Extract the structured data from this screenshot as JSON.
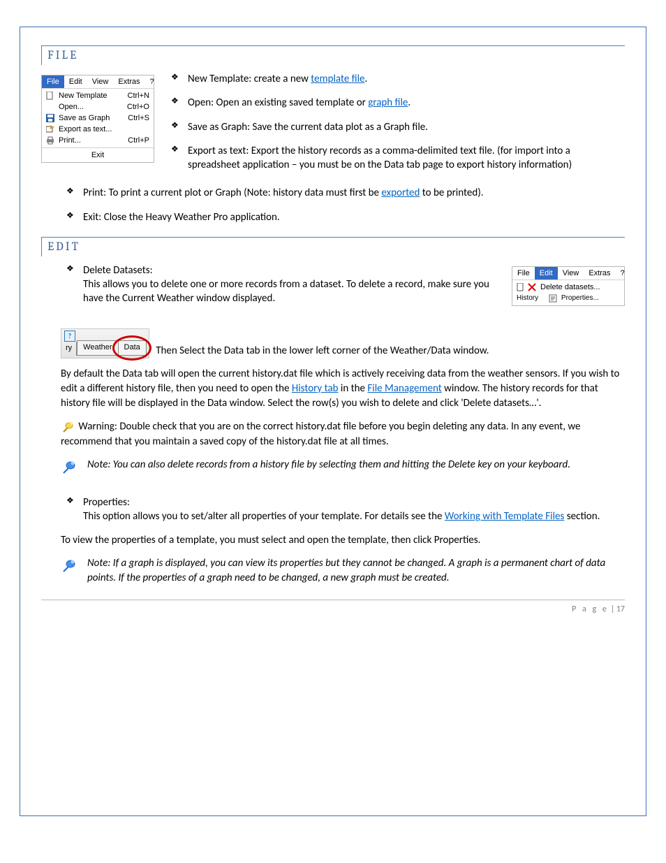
{
  "sections": {
    "file": {
      "heading": "FILE"
    },
    "edit": {
      "heading": "EDIT"
    }
  },
  "file_menu": {
    "bar": {
      "file": "File",
      "edit": "Edit",
      "view": "View",
      "extras": "Extras",
      "help": "?"
    },
    "items": {
      "new_template": {
        "label": "New Template",
        "shortcut": "Ctrl+N"
      },
      "open": {
        "label": "Open...",
        "shortcut": "Ctrl+O"
      },
      "save_as_graph": {
        "label": "Save as Graph",
        "shortcut": "Ctrl+S"
      },
      "export_as_text": {
        "label": "Export as text..."
      },
      "print": {
        "label": "Print...",
        "shortcut": "Ctrl+P"
      },
      "exit": {
        "label": "Exit"
      }
    }
  },
  "file_bullets": {
    "new_template": {
      "pre": "New Template: create a new ",
      "link": "template file",
      "post": "."
    },
    "open": {
      "pre": "Open: Open an existing saved template or ",
      "link": "graph file",
      "post": "."
    },
    "save_as_graph": "Save as Graph: Save the current data plot as a Graph file.",
    "export_as_text": "Export as text: Export the history records as a comma-delimited text file. (for import into a spreadsheet application – you must be on the Data tab page to export history information)",
    "print": {
      "pre": "Print: To print a current plot or Graph (Note: history data must first be ",
      "link": "exported",
      "post": " to be printed)."
    },
    "exit": "Exit: Close the Heavy Weather Pro application."
  },
  "edit_menu": {
    "bar": {
      "file": "File",
      "edit": "Edit",
      "view": "View",
      "extras": "Extras",
      "help": "?"
    },
    "second_row_label": "History",
    "items": {
      "delete_datasets": {
        "label": "Delete datasets..."
      },
      "properties": {
        "label": "Properties..."
      }
    }
  },
  "edit_content": {
    "delete_heading": "Delete Datasets:",
    "delete_text": "This allows you to delete one or more records from a dataset. To delete a record, make sure you have the Current Weather window displayed.",
    "tabs": {
      "frag": "ry",
      "weather": "Weather",
      "data": "Data"
    },
    "tab_sentence": "Then Select the Data tab in the lower left corner of the Weather/Data window.",
    "para1_pre": "By default the Data tab will open the current history.dat file which is actively receiving data from the weather sensors. If you wish to edit a different history file, then you need to open the ",
    "para1_link1": "History tab",
    "para1_mid": " in the ",
    "para1_link2": "File Management",
    "para1_post": " window. The history records for that history file will be displayed in the Data window. Select the row(s) you wish to delete and click 'Delete datasets…'.",
    "warning": "Warning: Double check that you are on the correct history.dat file before you begin deleting any data. In any event, we recommend that you maintain a saved copy of the history.dat file at all times.",
    "note1": "Note: You can also delete records from a history file by selecting them and hitting the Delete key on your keyboard.",
    "props_heading": "Properties:",
    "props_text_pre": "This option allows you to set/alter all properties of your template. For details see the ",
    "props_link": "Working with Template Files",
    "props_text_post": " section.",
    "props_view": "To view the properties of a template, you must select and open the template, then click Properties.",
    "note2": "Note: If a graph is displayed, you can view its properties but they cannot be changed. A graph is a permanent chart of data points. If the properties of a graph need to be changed, a new graph must be created."
  },
  "footer": {
    "label": "P a g e",
    "sep": " | ",
    "num": "17"
  }
}
